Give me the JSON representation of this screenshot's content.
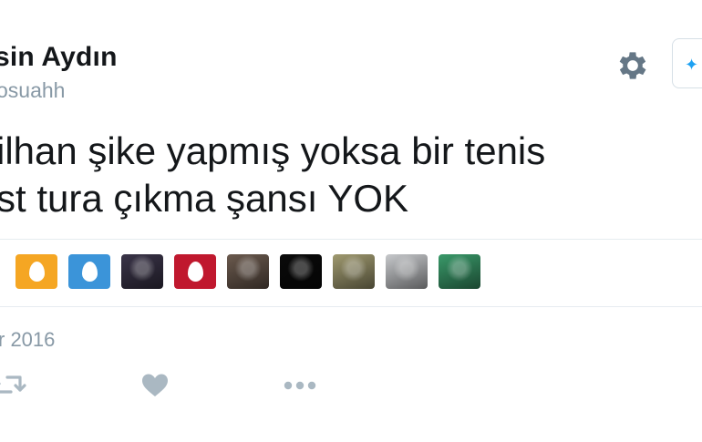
{
  "tweet": {
    "author_name": "sin Aydın",
    "author_handle": "osuahh",
    "text_lines": [
      "ilhan şike yapmış yoksa bir tenis",
      "st tura çıkma şansı YOK"
    ],
    "timestamp": "r 2016"
  },
  "liked_by_avatars": [
    {
      "kind": "egg",
      "color": "#f5a623"
    },
    {
      "kind": "egg",
      "color": "#3b94d9"
    },
    {
      "kind": "photo",
      "color": "#3a3448"
    },
    {
      "kind": "egg",
      "color": "#c0182e"
    },
    {
      "kind": "photo",
      "color": "#6b5a4e"
    },
    {
      "kind": "photo",
      "color": "#0a0a0a"
    },
    {
      "kind": "photo",
      "color": "#a09a70"
    },
    {
      "kind": "photo",
      "color": "#c7c9cc"
    },
    {
      "kind": "photo",
      "color": "#3a9a6a"
    }
  ],
  "icons": {
    "settings": "gear-icon",
    "follow": "follow-icon",
    "retweet": "retweet-icon",
    "like": "heart-icon",
    "more": "more-icon"
  },
  "colors": {
    "text": "#14171a",
    "secondary_text": "#8899a6",
    "divider": "#e6ecf0",
    "action_icon": "#aab8c2",
    "gear": "#657786",
    "accent": "#1da1f2"
  }
}
